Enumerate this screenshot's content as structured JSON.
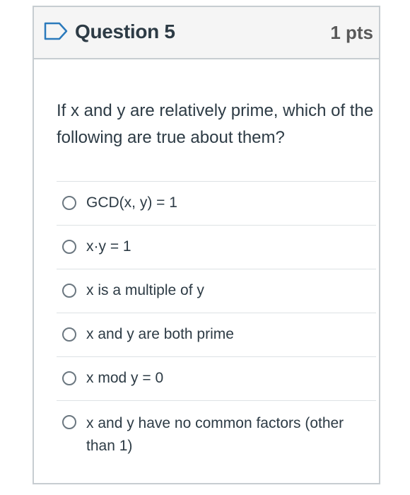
{
  "question": {
    "title": "Question 5",
    "points": "1 pts",
    "text": "If x and y are relatively prime, which of the following are true about them?",
    "flag_icon": "bookmark-flag-icon"
  },
  "answers": [
    {
      "label": "GCD(x, y) = 1"
    },
    {
      "label": "x·y = 1"
    },
    {
      "label": "x is a multiple of y"
    },
    {
      "label": "x and y are both prime"
    },
    {
      "label": "x mod y = 0"
    },
    {
      "label": "x and y have no common factors (other than 1)"
    }
  ],
  "colors": {
    "header_bg": "#f5f5f5",
    "border": "#c7cdd1",
    "text": "#2d3b45",
    "points_text": "#595959",
    "flag_stroke": "#2b7abc"
  }
}
